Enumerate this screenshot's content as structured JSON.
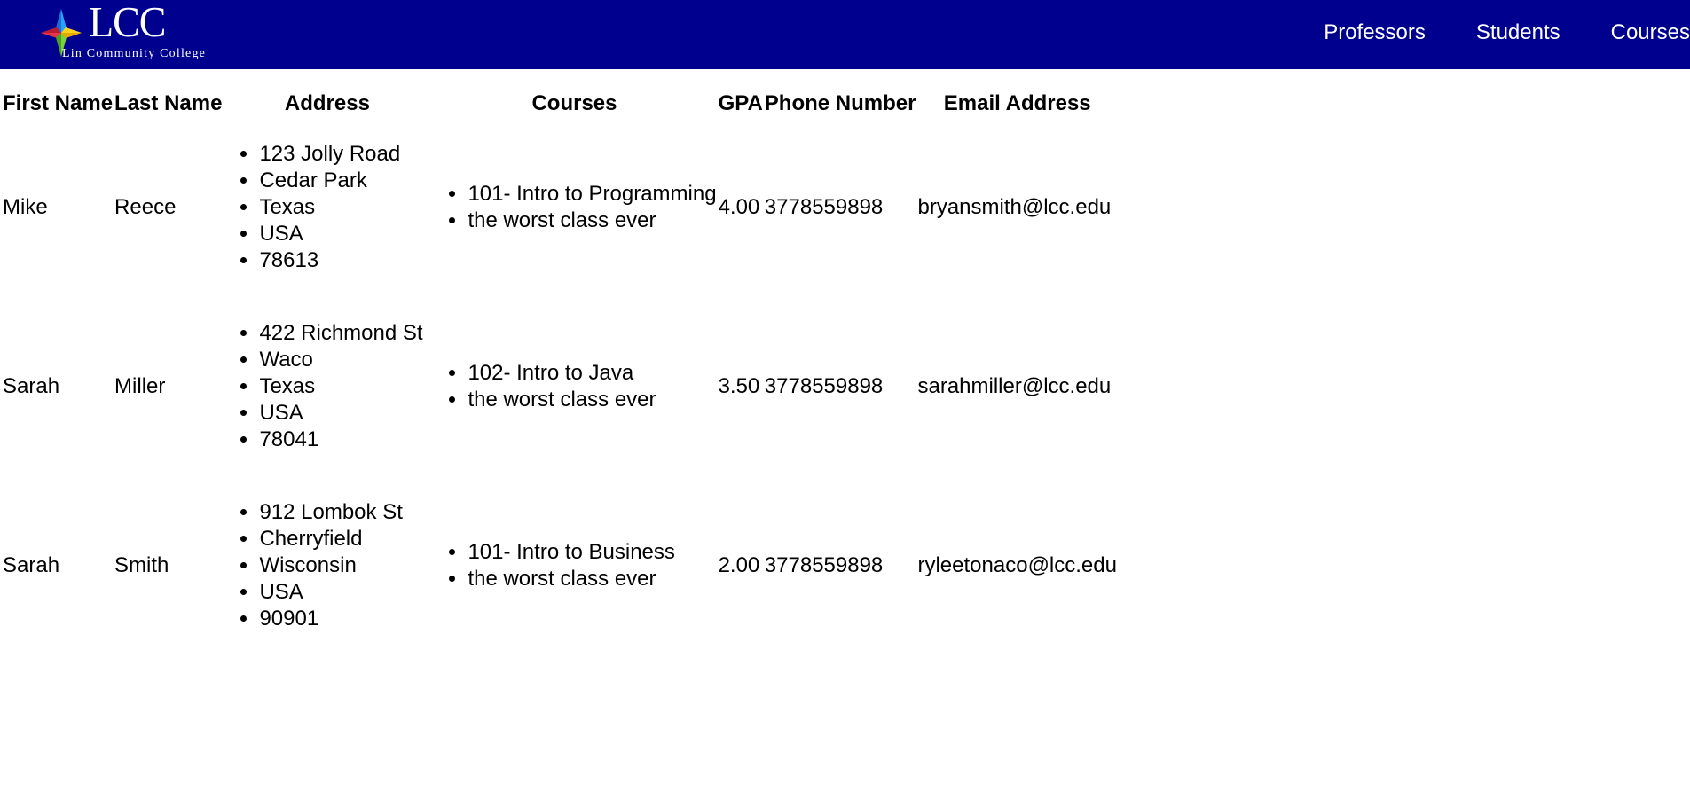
{
  "header": {
    "logo_title": "LCC",
    "logo_subtitle": "Lin Community College",
    "nav": [
      {
        "label": "Professors"
      },
      {
        "label": "Students"
      },
      {
        "label": "Courses"
      }
    ],
    "background_color": "#00008f",
    "logo_icon": "compass-star-icon"
  },
  "table": {
    "headers": [
      "First Name",
      "Last Name",
      "Address",
      "Courses",
      "GPA",
      "Phone Number",
      "Email Address"
    ],
    "rows": [
      {
        "first_name": "Mike",
        "last_name": "Reece",
        "address": [
          "123 Jolly Road",
          "Cedar Park",
          "Texas",
          "USA",
          "78613"
        ],
        "courses": [
          "101- Intro to Programming",
          "the worst class ever"
        ],
        "gpa": "4.00",
        "phone": "3778559898",
        "email": "bryansmith@lcc.edu"
      },
      {
        "first_name": "Sarah",
        "last_name": "Miller",
        "address": [
          "422 Richmond St",
          "Waco",
          "Texas",
          "USA",
          "78041"
        ],
        "courses": [
          "102- Intro to Java",
          "the worst class ever"
        ],
        "gpa": "3.50",
        "phone": "3778559898",
        "email": "sarahmiller@lcc.edu"
      },
      {
        "first_name": "Sarah",
        "last_name": "Smith",
        "address": [
          "912 Lombok St",
          "Cherryfield",
          "Wisconsin",
          "USA",
          "90901"
        ],
        "courses": [
          "101- Intro to Business",
          "the worst class ever"
        ],
        "gpa": "2.00",
        "phone": "3778559898",
        "email": "ryleetonaco@lcc.edu"
      }
    ]
  }
}
